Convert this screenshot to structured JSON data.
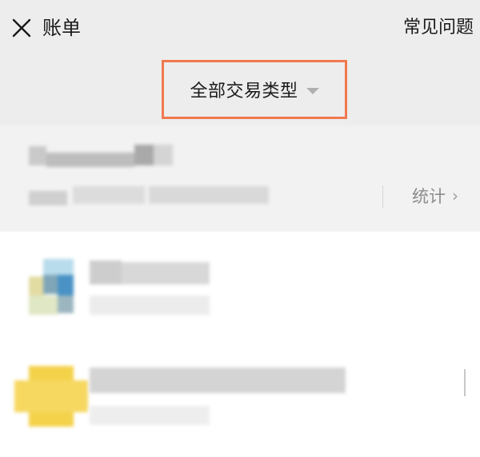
{
  "header": {
    "title": "账单",
    "faq_label": "常见问题",
    "filter_label": "全部交易类型",
    "accent_color": "#f07a4f"
  },
  "summary": {
    "stats_label": "统计",
    "chevron": "›"
  },
  "icons": {
    "close": "close-icon",
    "caret": "caret-down-icon",
    "chevron": "chevron-right-icon"
  }
}
